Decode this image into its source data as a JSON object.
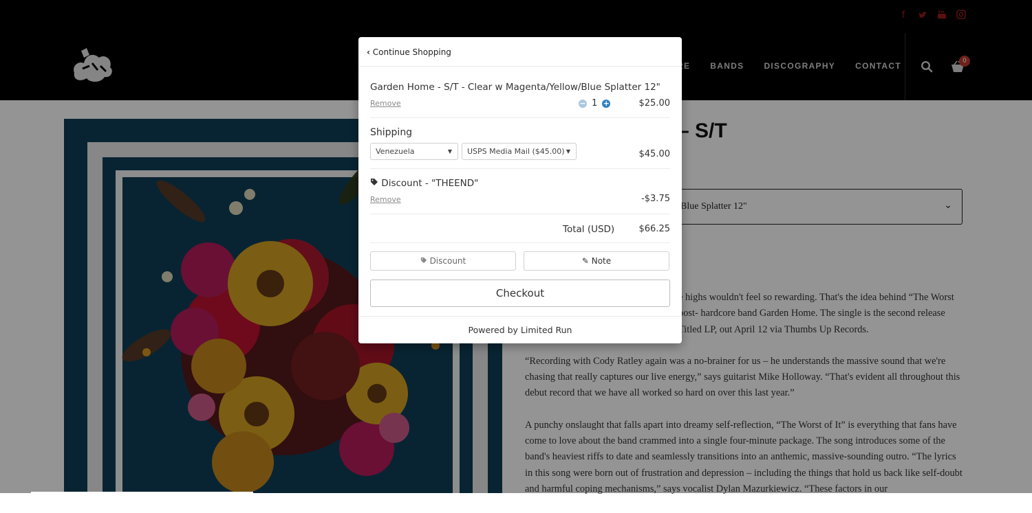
{
  "site": {
    "social_icons": [
      "facebook-icon",
      "twitter-icon",
      "youtube-icon",
      "instagram-icon"
    ],
    "nav": [
      "RE",
      "BANDS",
      "DISCOGRAPHY",
      "CONTACT"
    ],
    "cart_count": "0"
  },
  "product": {
    "title": "– S/T",
    "variant_text": "Blue Splatter 12\"",
    "description": [
      "e highs wouldn't feel so rewarding. That's the idea behind “The Worst post- hardcore band Garden Home. The single is the second release Titled LP, out April 12 via Thumbs Up Records.",
      "“Recording with Cody Ratley again was a no-brainer for us – he understands the massive sound that we're chasing that really captures our live energy,” says guitarist Mike Holloway. “That's evident all throughout this debut record that we have all worked so hard on over this last year.”",
      "A punchy onslaught that falls apart into dreamy self-reflection, “The Worst of It” is everything that fans have come to love about the band crammed into a single four-minute package. The song introduces some of the band's heaviest riffs to date and seamlessly transitions into an anthemic, massive-sounding outro. “The lyrics in this song were born out of frustration and depression – including the things that hold us back like self-doubt and harmful coping mechanisms,” says vocalist Dylan Mazurkiewicz. “These factors in our"
    ]
  },
  "cart": {
    "continue_label": "Continue Shopping",
    "item": {
      "title": "Garden Home - S/T - Clear w Magenta/Yellow/Blue Splatter 12\"",
      "remove_label": "Remove",
      "quantity": "1",
      "price": "$25.00"
    },
    "shipping": {
      "label": "Shipping",
      "country": "Venezuela",
      "method": "USPS Media Mail ($45.00)",
      "price": "$45.00"
    },
    "discount": {
      "label": "Discount - \"THEEND\"",
      "remove_label": "Remove",
      "amount": "-$3.75"
    },
    "total_label": "Total (USD)",
    "total": "$66.25",
    "discount_button": "Discount",
    "note_button": "Note",
    "checkout_button": "Checkout",
    "powered_by": "Powered by Limited Run"
  }
}
